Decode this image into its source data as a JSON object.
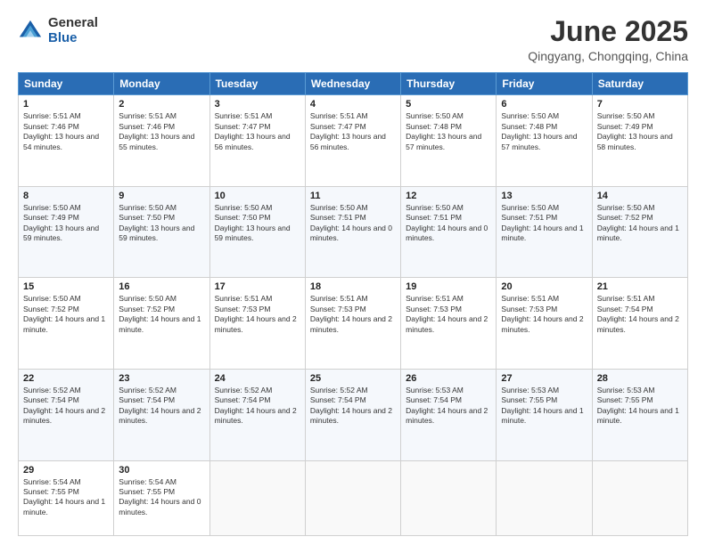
{
  "header": {
    "logo_general": "General",
    "logo_blue": "Blue",
    "month_title": "June 2025",
    "location": "Qingyang, Chongqing, China"
  },
  "weekdays": [
    "Sunday",
    "Monday",
    "Tuesday",
    "Wednesday",
    "Thursday",
    "Friday",
    "Saturday"
  ],
  "weeks": [
    [
      {
        "day": "1",
        "rise": "Sunrise: 5:51 AM",
        "set": "Sunset: 7:46 PM",
        "daylight": "Daylight: 13 hours and 54 minutes."
      },
      {
        "day": "2",
        "rise": "Sunrise: 5:51 AM",
        "set": "Sunset: 7:46 PM",
        "daylight": "Daylight: 13 hours and 55 minutes."
      },
      {
        "day": "3",
        "rise": "Sunrise: 5:51 AM",
        "set": "Sunset: 7:47 PM",
        "daylight": "Daylight: 13 hours and 56 minutes."
      },
      {
        "day": "4",
        "rise": "Sunrise: 5:51 AM",
        "set": "Sunset: 7:47 PM",
        "daylight": "Daylight: 13 hours and 56 minutes."
      },
      {
        "day": "5",
        "rise": "Sunrise: 5:50 AM",
        "set": "Sunset: 7:48 PM",
        "daylight": "Daylight: 13 hours and 57 minutes."
      },
      {
        "day": "6",
        "rise": "Sunrise: 5:50 AM",
        "set": "Sunset: 7:48 PM",
        "daylight": "Daylight: 13 hours and 57 minutes."
      },
      {
        "day": "7",
        "rise": "Sunrise: 5:50 AM",
        "set": "Sunset: 7:49 PM",
        "daylight": "Daylight: 13 hours and 58 minutes."
      }
    ],
    [
      {
        "day": "8",
        "rise": "Sunrise: 5:50 AM",
        "set": "Sunset: 7:49 PM",
        "daylight": "Daylight: 13 hours and 59 minutes."
      },
      {
        "day": "9",
        "rise": "Sunrise: 5:50 AM",
        "set": "Sunset: 7:50 PM",
        "daylight": "Daylight: 13 hours and 59 minutes."
      },
      {
        "day": "10",
        "rise": "Sunrise: 5:50 AM",
        "set": "Sunset: 7:50 PM",
        "daylight": "Daylight: 13 hours and 59 minutes."
      },
      {
        "day": "11",
        "rise": "Sunrise: 5:50 AM",
        "set": "Sunset: 7:51 PM",
        "daylight": "Daylight: 14 hours and 0 minutes."
      },
      {
        "day": "12",
        "rise": "Sunrise: 5:50 AM",
        "set": "Sunset: 7:51 PM",
        "daylight": "Daylight: 14 hours and 0 minutes."
      },
      {
        "day": "13",
        "rise": "Sunrise: 5:50 AM",
        "set": "Sunset: 7:51 PM",
        "daylight": "Daylight: 14 hours and 1 minute."
      },
      {
        "day": "14",
        "rise": "Sunrise: 5:50 AM",
        "set": "Sunset: 7:52 PM",
        "daylight": "Daylight: 14 hours and 1 minute."
      }
    ],
    [
      {
        "day": "15",
        "rise": "Sunrise: 5:50 AM",
        "set": "Sunset: 7:52 PM",
        "daylight": "Daylight: 14 hours and 1 minute."
      },
      {
        "day": "16",
        "rise": "Sunrise: 5:50 AM",
        "set": "Sunset: 7:52 PM",
        "daylight": "Daylight: 14 hours and 1 minute."
      },
      {
        "day": "17",
        "rise": "Sunrise: 5:51 AM",
        "set": "Sunset: 7:53 PM",
        "daylight": "Daylight: 14 hours and 2 minutes."
      },
      {
        "day": "18",
        "rise": "Sunrise: 5:51 AM",
        "set": "Sunset: 7:53 PM",
        "daylight": "Daylight: 14 hours and 2 minutes."
      },
      {
        "day": "19",
        "rise": "Sunrise: 5:51 AM",
        "set": "Sunset: 7:53 PM",
        "daylight": "Daylight: 14 hours and 2 minutes."
      },
      {
        "day": "20",
        "rise": "Sunrise: 5:51 AM",
        "set": "Sunset: 7:53 PM",
        "daylight": "Daylight: 14 hours and 2 minutes."
      },
      {
        "day": "21",
        "rise": "Sunrise: 5:51 AM",
        "set": "Sunset: 7:54 PM",
        "daylight": "Daylight: 14 hours and 2 minutes."
      }
    ],
    [
      {
        "day": "22",
        "rise": "Sunrise: 5:52 AM",
        "set": "Sunset: 7:54 PM",
        "daylight": "Daylight: 14 hours and 2 minutes."
      },
      {
        "day": "23",
        "rise": "Sunrise: 5:52 AM",
        "set": "Sunset: 7:54 PM",
        "daylight": "Daylight: 14 hours and 2 minutes."
      },
      {
        "day": "24",
        "rise": "Sunrise: 5:52 AM",
        "set": "Sunset: 7:54 PM",
        "daylight": "Daylight: 14 hours and 2 minutes."
      },
      {
        "day": "25",
        "rise": "Sunrise: 5:52 AM",
        "set": "Sunset: 7:54 PM",
        "daylight": "Daylight: 14 hours and 2 minutes."
      },
      {
        "day": "26",
        "rise": "Sunrise: 5:53 AM",
        "set": "Sunset: 7:54 PM",
        "daylight": "Daylight: 14 hours and 2 minutes."
      },
      {
        "day": "27",
        "rise": "Sunrise: 5:53 AM",
        "set": "Sunset: 7:55 PM",
        "daylight": "Daylight: 14 hours and 1 minute."
      },
      {
        "day": "28",
        "rise": "Sunrise: 5:53 AM",
        "set": "Sunset: 7:55 PM",
        "daylight": "Daylight: 14 hours and 1 minute."
      }
    ],
    [
      {
        "day": "29",
        "rise": "Sunrise: 5:54 AM",
        "set": "Sunset: 7:55 PM",
        "daylight": "Daylight: 14 hours and 1 minute."
      },
      {
        "day": "30",
        "rise": "Sunrise: 5:54 AM",
        "set": "Sunset: 7:55 PM",
        "daylight": "Daylight: 14 hours and 0 minutes."
      },
      null,
      null,
      null,
      null,
      null
    ]
  ]
}
